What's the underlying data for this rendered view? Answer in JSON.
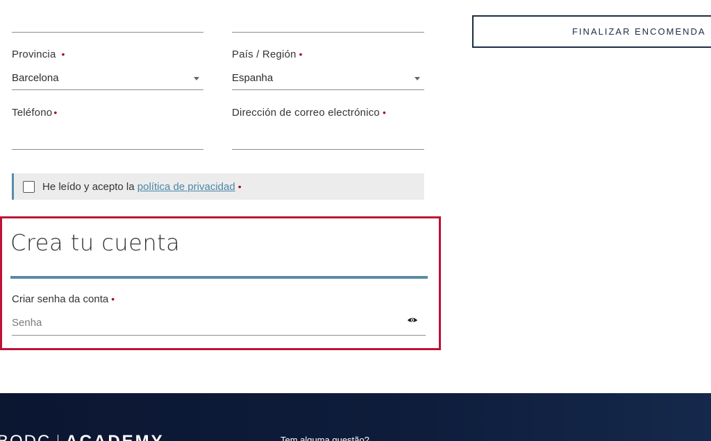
{
  "form": {
    "province": {
      "label": "Provincia",
      "required_mark": "•",
      "value": "Barcelona"
    },
    "country": {
      "label": "País / Región",
      "required_mark": "•",
      "value": "Espanha"
    },
    "phone": {
      "label": "Teléfono",
      "required_mark": "•"
    },
    "email": {
      "label": "Dirección de correo electrónico",
      "required_mark": "•"
    },
    "privacy": {
      "text_before": "He leído y acepto la ",
      "link_text": "política de privacidad",
      "required_mark": "•"
    }
  },
  "order": {
    "finalize_label": "FINALIZAR ENCOMENDA"
  },
  "account": {
    "title": "Crea tu cuenta",
    "password_label": "Criar senha da conta",
    "required_mark": "•",
    "password_placeholder": "Senha"
  },
  "footer": {
    "logo_left": "BODC",
    "logo_right": "ACADEMY",
    "question": "Tem alguma questão?"
  },
  "colors": {
    "highlight_border": "#bf1035",
    "accent_rule": "#5a8aa6",
    "required": "#a50d1f",
    "footer_bg": "#0b1631",
    "button_border": "#1b2b44"
  }
}
